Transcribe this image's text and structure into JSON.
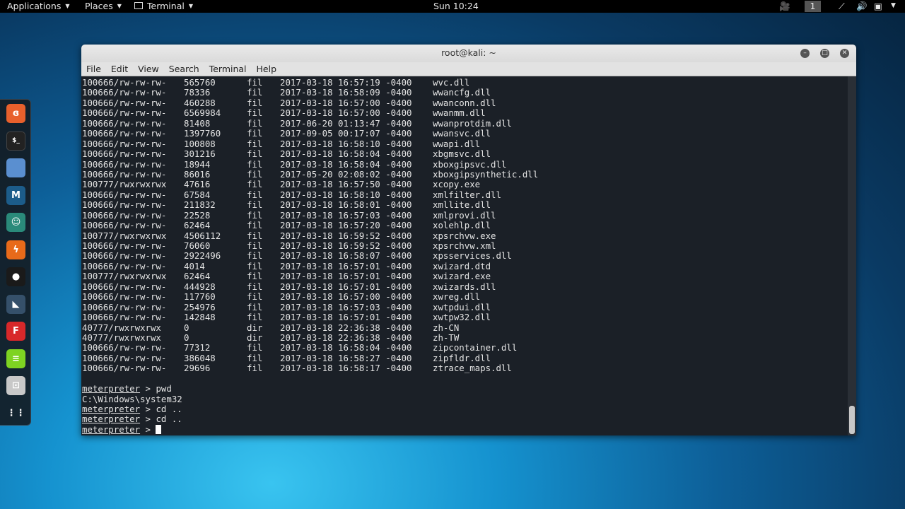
{
  "topbar": {
    "applications": "Applications",
    "places": "Places",
    "terminal": "Terminal",
    "clock": "Sun 10:24",
    "workspace": "1"
  },
  "window": {
    "title": "root@kali: ~",
    "menu": [
      "File",
      "Edit",
      "View",
      "Search",
      "Terminal",
      "Help"
    ]
  },
  "dock": [
    "firefox-icon",
    "terminal-icon",
    "files-icon",
    "metasploit-icon",
    "armitage-icon",
    "burpsuite-icon",
    "maltego-icon",
    "beef-icon",
    "faraday-icon",
    "leafpad-icon",
    "cutycapt-icon",
    "show-apps-icon"
  ],
  "listing": [
    [
      "100666/rw-rw-rw-",
      "565760",
      "fil",
      "2017-03-18 16:57:19 -0400",
      "wvc.dll"
    ],
    [
      "100666/rw-rw-rw-",
      "78336",
      "fil",
      "2017-03-18 16:58:09 -0400",
      "wwancfg.dll"
    ],
    [
      "100666/rw-rw-rw-",
      "460288",
      "fil",
      "2017-03-18 16:57:00 -0400",
      "wwanconn.dll"
    ],
    [
      "100666/rw-rw-rw-",
      "6569984",
      "fil",
      "2017-03-18 16:57:00 -0400",
      "wwanmm.dll"
    ],
    [
      "100666/rw-rw-rw-",
      "81408",
      "fil",
      "2017-06-20 01:13:47 -0400",
      "wwanprotdim.dll"
    ],
    [
      "100666/rw-rw-rw-",
      "1397760",
      "fil",
      "2017-09-05 00:17:07 -0400",
      "wwansvc.dll"
    ],
    [
      "100666/rw-rw-rw-",
      "100808",
      "fil",
      "2017-03-18 16:58:10 -0400",
      "wwapi.dll"
    ],
    [
      "100666/rw-rw-rw-",
      "301216",
      "fil",
      "2017-03-18 16:58:04 -0400",
      "xbgmsvc.dll"
    ],
    [
      "100666/rw-rw-rw-",
      "18944",
      "fil",
      "2017-03-18 16:58:04 -0400",
      "xboxgipsvc.dll"
    ],
    [
      "100666/rw-rw-rw-",
      "86016",
      "fil",
      "2017-05-20 02:08:02 -0400",
      "xboxgipsynthetic.dll"
    ],
    [
      "100777/rwxrwxrwx",
      "47616",
      "fil",
      "2017-03-18 16:57:50 -0400",
      "xcopy.exe"
    ],
    [
      "100666/rw-rw-rw-",
      "67584",
      "fil",
      "2017-03-18 16:58:10 -0400",
      "xmlfilter.dll"
    ],
    [
      "100666/rw-rw-rw-",
      "211832",
      "fil",
      "2017-03-18 16:58:01 -0400",
      "xmllite.dll"
    ],
    [
      "100666/rw-rw-rw-",
      "22528",
      "fil",
      "2017-03-18 16:57:03 -0400",
      "xmlprovi.dll"
    ],
    [
      "100666/rw-rw-rw-",
      "62464",
      "fil",
      "2017-03-18 16:57:20 -0400",
      "xolehlp.dll"
    ],
    [
      "100777/rwxrwxrwx",
      "4506112",
      "fil",
      "2017-03-18 16:59:52 -0400",
      "xpsrchvw.exe"
    ],
    [
      "100666/rw-rw-rw-",
      "76060",
      "fil",
      "2017-03-18 16:59:52 -0400",
      "xpsrchvw.xml"
    ],
    [
      "100666/rw-rw-rw-",
      "2922496",
      "fil",
      "2017-03-18 16:58:07 -0400",
      "xpsservices.dll"
    ],
    [
      "100666/rw-rw-rw-",
      "4014",
      "fil",
      "2017-03-18 16:57:01 -0400",
      "xwizard.dtd"
    ],
    [
      "100777/rwxrwxrwx",
      "62464",
      "fil",
      "2017-03-18 16:57:01 -0400",
      "xwizard.exe"
    ],
    [
      "100666/rw-rw-rw-",
      "444928",
      "fil",
      "2017-03-18 16:57:01 -0400",
      "xwizards.dll"
    ],
    [
      "100666/rw-rw-rw-",
      "117760",
      "fil",
      "2017-03-18 16:57:00 -0400",
      "xwreg.dll"
    ],
    [
      "100666/rw-rw-rw-",
      "254976",
      "fil",
      "2017-03-18 16:57:03 -0400",
      "xwtpdui.dll"
    ],
    [
      "100666/rw-rw-rw-",
      "142848",
      "fil",
      "2017-03-18 16:57:01 -0400",
      "xwtpw32.dll"
    ],
    [
      "40777/rwxrwxrwx",
      "0",
      "dir",
      "2017-03-18 22:36:38 -0400",
      "zh-CN"
    ],
    [
      "40777/rwxrwxrwx",
      "0",
      "dir",
      "2017-03-18 22:36:38 -0400",
      "zh-TW"
    ],
    [
      "100666/rw-rw-rw-",
      "77312",
      "fil",
      "2017-03-18 16:58:04 -0400",
      "zipcontainer.dll"
    ],
    [
      "100666/rw-rw-rw-",
      "386048",
      "fil",
      "2017-03-18 16:58:27 -0400",
      "zipfldr.dll"
    ],
    [
      "100666/rw-rw-rw-",
      "29696",
      "fil",
      "2017-03-18 16:58:17 -0400",
      "ztrace_maps.dll"
    ]
  ],
  "session": [
    {
      "prompt": "meterpreter",
      "cmd": " > pwd"
    },
    {
      "output": "C:\\Windows\\system32"
    },
    {
      "prompt": "meterpreter",
      "cmd": " > cd .."
    },
    {
      "prompt": "meterpreter",
      "cmd": " > cd .."
    },
    {
      "prompt": "meterpreter",
      "cmd": " > ",
      "cursor": true
    }
  ]
}
